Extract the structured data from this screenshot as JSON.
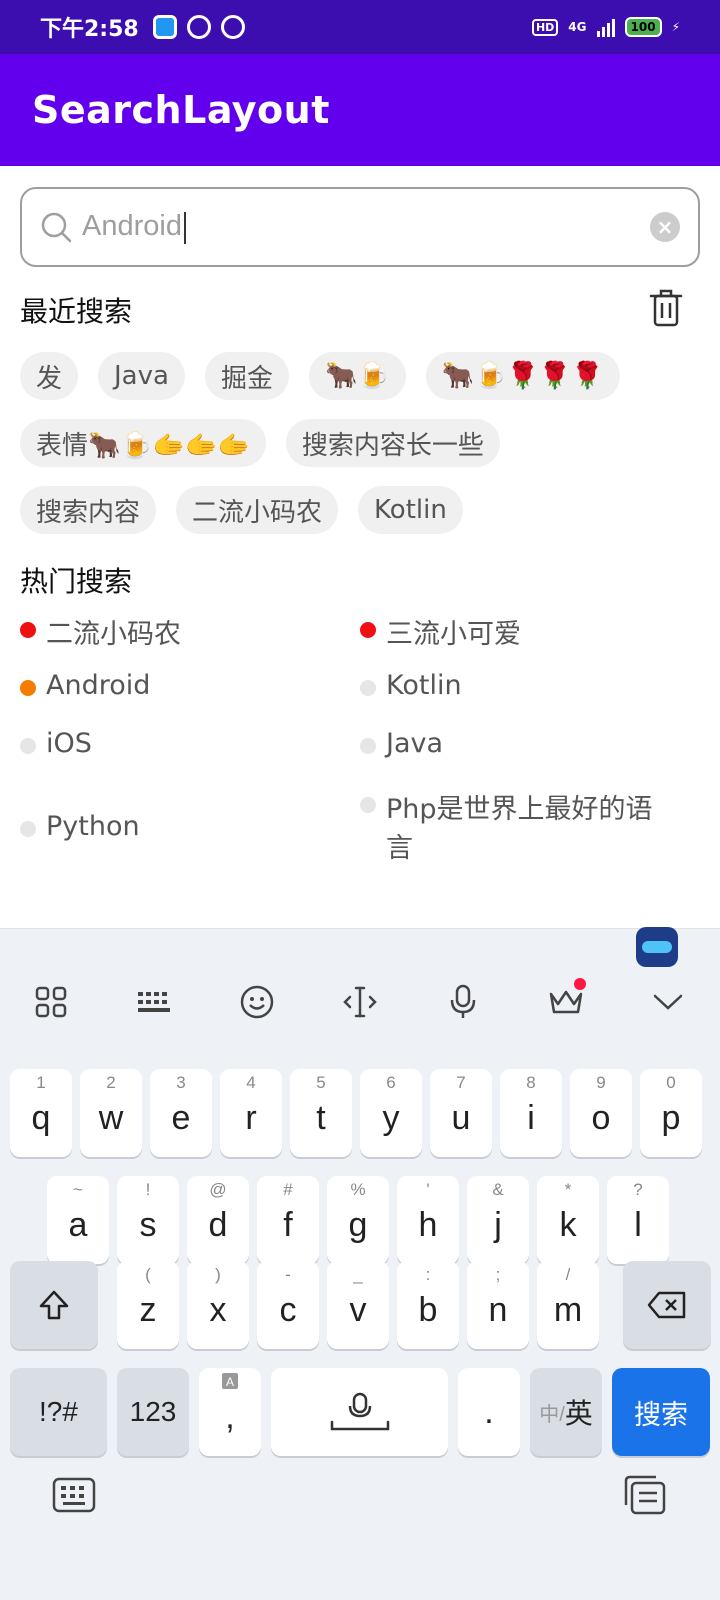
{
  "status_bar": {
    "time": "下午2:58",
    "hd": "HD",
    "network": "4G",
    "battery": "100"
  },
  "app_bar": {
    "title": "SearchLayout"
  },
  "search": {
    "value": "Android"
  },
  "recent": {
    "title": "最近搜索",
    "rows": [
      [
        "发",
        "Java",
        "掘金",
        "🐂🍺",
        "🐂🍺🌹🌹🌹"
      ],
      [
        "表情🐂🍺🫱🫱🫱",
        "搜索内容长一些"
      ],
      [
        "搜索内容",
        "二流小码农",
        "Kotlin"
      ]
    ]
  },
  "hot": {
    "title": "热门搜索",
    "items": [
      {
        "label": "二流小码农",
        "color": "#ee1111"
      },
      {
        "label": "三流小可爱",
        "color": "#ee1111"
      },
      {
        "label": "Android",
        "color": "#f57c00"
      },
      {
        "label": "Kotlin",
        "color": "#e6e6e6"
      },
      {
        "label": "iOS",
        "color": "#e6e6e6"
      },
      {
        "label": "Java",
        "color": "#e6e6e6"
      },
      {
        "label": "Python",
        "color": "#e6e6e6"
      },
      {
        "label": "Php是世界上最好的语言",
        "color": "#e6e6e6"
      }
    ]
  },
  "keyboard": {
    "row1": [
      {
        "k": "q",
        "s": "1"
      },
      {
        "k": "w",
        "s": "2"
      },
      {
        "k": "e",
        "s": "3"
      },
      {
        "k": "r",
        "s": "4"
      },
      {
        "k": "t",
        "s": "5"
      },
      {
        "k": "y",
        "s": "6"
      },
      {
        "k": "u",
        "s": "7"
      },
      {
        "k": "i",
        "s": "8"
      },
      {
        "k": "o",
        "s": "9"
      },
      {
        "k": "p",
        "s": "0"
      }
    ],
    "row2": [
      {
        "k": "a",
        "s": "~"
      },
      {
        "k": "s",
        "s": "!"
      },
      {
        "k": "d",
        "s": "@"
      },
      {
        "k": "f",
        "s": "#"
      },
      {
        "k": "g",
        "s": "%"
      },
      {
        "k": "h",
        "s": "'"
      },
      {
        "k": "j",
        "s": "&"
      },
      {
        "k": "k",
        "s": "*"
      },
      {
        "k": "l",
        "s": "?"
      }
    ],
    "row3": [
      {
        "k": "z",
        "s": "("
      },
      {
        "k": "x",
        "s": ")"
      },
      {
        "k": "c",
        "s": "-"
      },
      {
        "k": "v",
        "s": "_"
      },
      {
        "k": "b",
        "s": ":"
      },
      {
        "k": "n",
        "s": ";"
      },
      {
        "k": "m",
        "s": "/"
      }
    ],
    "symbols_label": "!?#",
    "numbers_label": "123",
    "comma_label": ",",
    "period_label": ".",
    "lang_label_cn": "中/",
    "lang_label_en": "英",
    "search_label": "搜索"
  }
}
